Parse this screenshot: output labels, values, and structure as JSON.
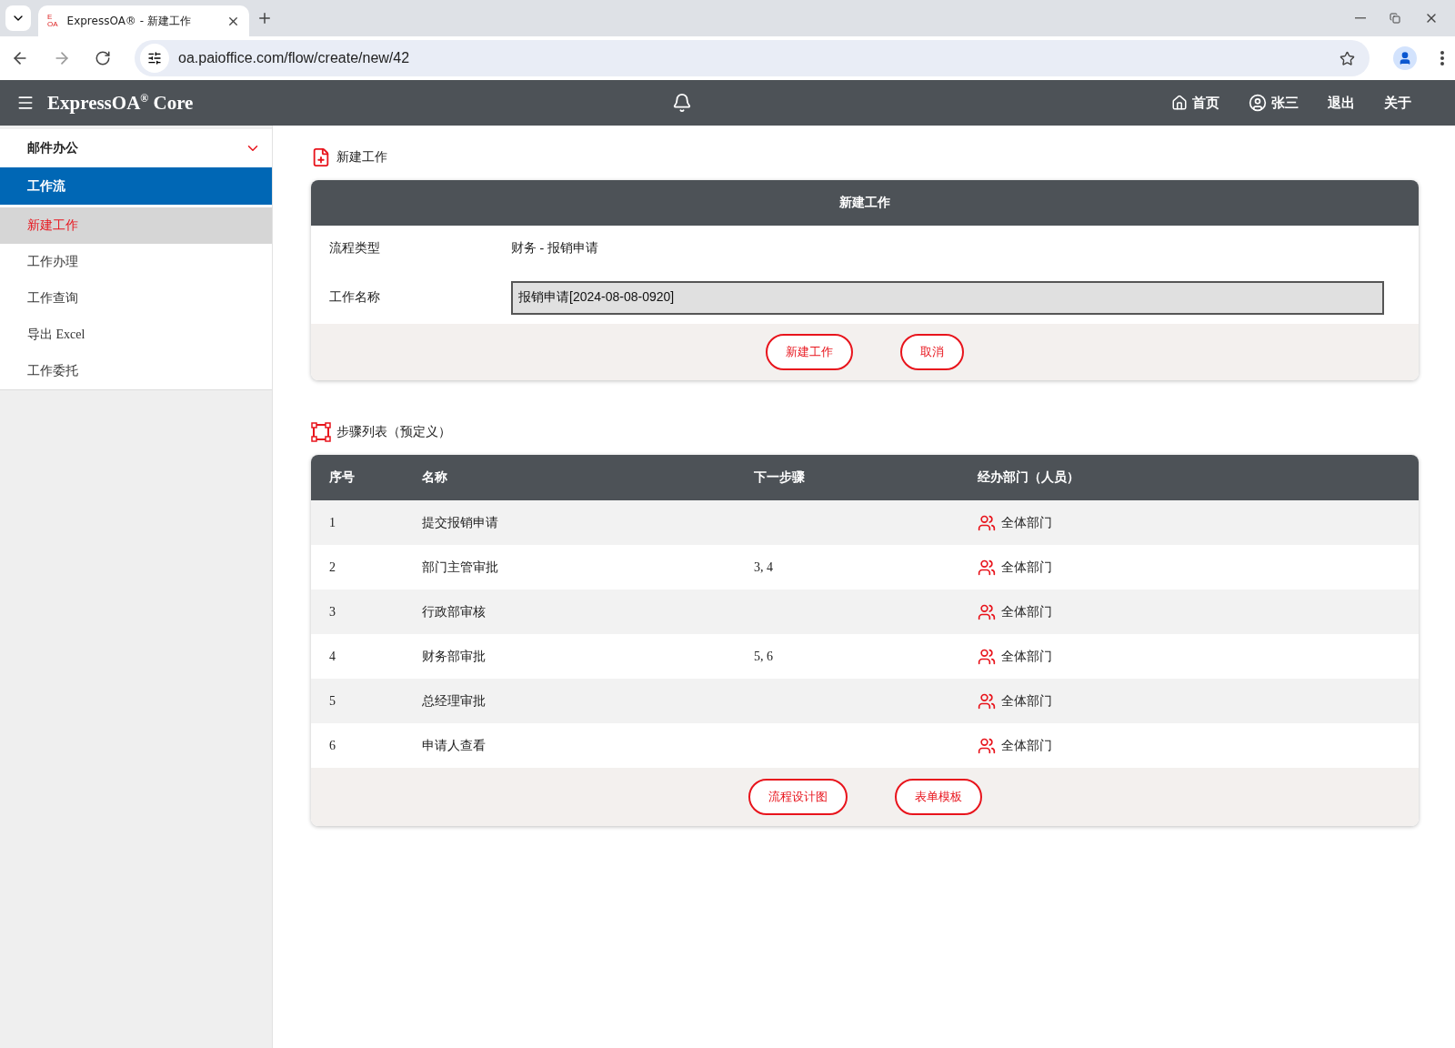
{
  "browser": {
    "tab_title": "ExpressOA® - 新建工作",
    "favicon_text": [
      "E",
      "OA"
    ],
    "url": "oa.paioffice.com/flow/create/new/42"
  },
  "header": {
    "brand": "ExpressOA$^{®}$ Core",
    "nav": [
      {
        "kind": "home",
        "label": "首页"
      },
      {
        "kind": "user",
        "label": "张三"
      },
      {
        "kind": "plain",
        "label": "退出"
      },
      {
        "kind": "plain",
        "label": "关于"
      }
    ]
  },
  "sidebar": {
    "group": {
      "label": "邮件办公",
      "expanded": true
    },
    "section": "工作流",
    "items": [
      {
        "label": "新建工作",
        "selected": true
      },
      {
        "label": "工作办理",
        "selected": false
      },
      {
        "label": "工作查询",
        "selected": false
      },
      {
        "label": "导出 Excel",
        "selected": false
      },
      {
        "label": "工作委托",
        "selected": false
      }
    ]
  },
  "new_work": {
    "heading": "新建工作",
    "card_title": "新建工作",
    "type_label": "流程类型",
    "type_value": "财务 - 报销申请",
    "name_label": "工作名称",
    "name_value": "报销申请[2024-08-08-0920]",
    "buttons": [
      "新建工作",
      "取消"
    ]
  },
  "steps": {
    "heading": "步骤列表（预定义）",
    "columns": [
      "序号",
      "名称",
      "下一步骤",
      "经办部门（人员）"
    ],
    "rows": [
      {
        "no": "1",
        "name": "提交报销申请",
        "next": "",
        "dept": "全体部门"
      },
      {
        "no": "2",
        "name": "部门主管审批",
        "next": "3, 4",
        "dept": "全体部门"
      },
      {
        "no": "3",
        "name": "行政部审核",
        "next": "",
        "dept": "全体部门"
      },
      {
        "no": "4",
        "name": "财务部审批",
        "next": "5, 6",
        "dept": "全体部门"
      },
      {
        "no": "5",
        "name": "总经理审批",
        "next": "",
        "dept": "全体部门"
      },
      {
        "no": "6",
        "name": "申请人查看",
        "next": "",
        "dept": "全体部门"
      }
    ],
    "buttons": [
      "流程设计图",
      "表单模板"
    ]
  }
}
